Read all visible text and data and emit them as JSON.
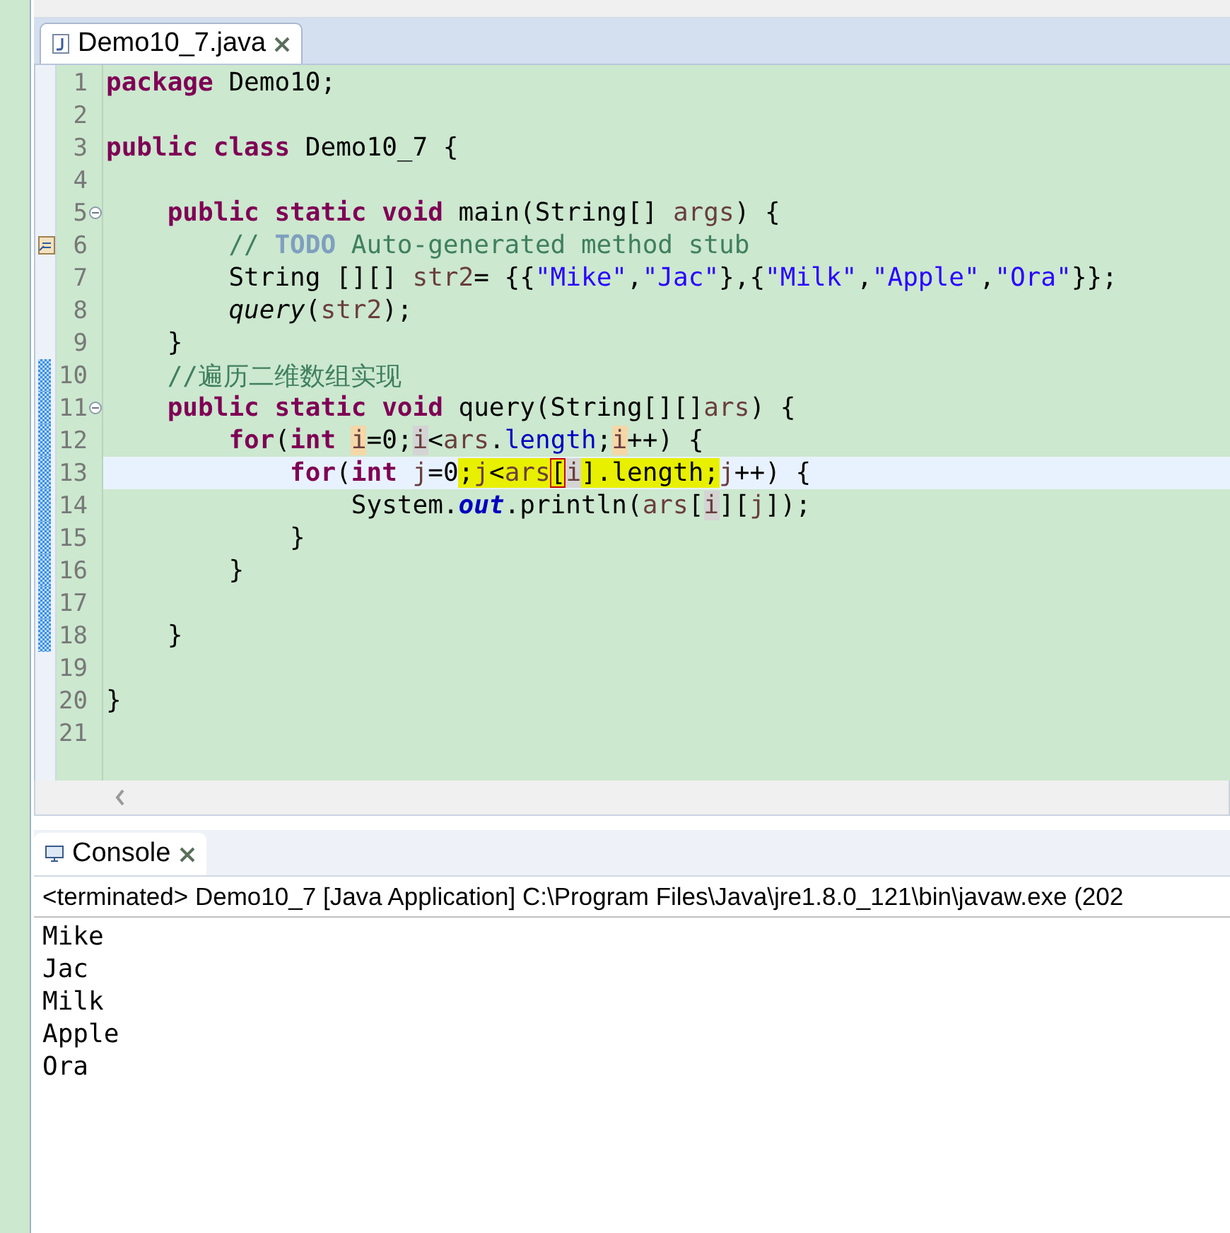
{
  "editor_tab": {
    "title": "Demo10_7.java",
    "selected": true
  },
  "code_lines": [
    {
      "number": "1",
      "current": false,
      "changed": false,
      "fold": false,
      "task": false,
      "tokens": [
        {
          "t": "package ",
          "kind": "kw"
        },
        {
          "t": "Demo10;",
          "kind": "p"
        }
      ]
    },
    {
      "number": "2",
      "current": false,
      "changed": false,
      "fold": false,
      "task": false
    },
    {
      "number": "3",
      "current": false,
      "changed": false,
      "fold": false,
      "task": false,
      "tokens": [
        {
          "t": "public class ",
          "kind": "kw"
        },
        {
          "t": "Demo10_7 {",
          "kind": "p"
        }
      ]
    },
    {
      "number": "4",
      "current": false,
      "changed": false,
      "fold": false,
      "task": false
    },
    {
      "number": "5",
      "current": false,
      "changed": false,
      "fold": true,
      "task": false,
      "tokens": [
        {
          "t": "    public static void ",
          "kind": "kw"
        },
        {
          "t": "main(String[] ",
          "kind": "p"
        },
        {
          "t": "args",
          "kind": "v"
        },
        {
          "t": ") {",
          "kind": "p"
        }
      ]
    },
    {
      "number": "6",
      "current": false,
      "changed": false,
      "fold": false,
      "task": true,
      "tokens": [
        {
          "t": "        // ",
          "kind": "c"
        },
        {
          "t": "TODO",
          "kind": "todo"
        },
        {
          "t": " Auto-generated method stub",
          "kind": "c"
        }
      ]
    },
    {
      "number": "7",
      "current": false,
      "changed": false,
      "fold": false,
      "task": false,
      "tokens": [
        {
          "t": "        String [][] ",
          "kind": "p"
        },
        {
          "t": "str2",
          "kind": "v"
        },
        {
          "t": "= {{",
          "kind": "p"
        },
        {
          "t": "\"Mike\"",
          "kind": "s"
        },
        {
          "t": ",",
          "kind": "p"
        },
        {
          "t": "\"Jac\"",
          "kind": "s"
        },
        {
          "t": "},{",
          "kind": "p"
        },
        {
          "t": "\"Milk\"",
          "kind": "s"
        },
        {
          "t": ",",
          "kind": "p"
        },
        {
          "t": "\"Apple\"",
          "kind": "s"
        },
        {
          "t": ",",
          "kind": "p"
        },
        {
          "t": "\"Ora\"",
          "kind": "s"
        },
        {
          "t": "}};",
          "kind": "p"
        }
      ]
    },
    {
      "number": "8",
      "current": false,
      "changed": false,
      "fold": false,
      "task": false,
      "tokens": [
        {
          "t": "        query",
          "kind": "m"
        },
        {
          "t": "(",
          "kind": "p"
        },
        {
          "t": "str2",
          "kind": "v"
        },
        {
          "t": ");",
          "kind": "p"
        }
      ]
    },
    {
      "number": "9",
      "current": false,
      "changed": false,
      "fold": false,
      "task": false,
      "tokens": [
        {
          "t": "    }",
          "kind": "p"
        }
      ]
    },
    {
      "number": "10",
      "current": false,
      "changed": true,
      "fold": false,
      "task": false,
      "tokens": [
        {
          "t": "    //遍历二维数组实现",
          "kind": "c"
        }
      ]
    },
    {
      "number": "11",
      "current": false,
      "changed": true,
      "fold": true,
      "task": false,
      "tokens": [
        {
          "t": "    public static void ",
          "kind": "kw"
        },
        {
          "t": "query(String[][]",
          "kind": "p"
        },
        {
          "t": "ars",
          "kind": "v"
        },
        {
          "t": ") {",
          "kind": "p"
        }
      ]
    },
    {
      "number": "12",
      "current": false,
      "changed": true,
      "fold": false,
      "task": false,
      "tokens": [
        {
          "t": "        for",
          "kind": "kw"
        },
        {
          "t": "(",
          "kind": "p"
        },
        {
          "t": "int ",
          "kind": "kw"
        },
        {
          "t": "i",
          "kind": "v",
          "write_occurrence": true
        },
        {
          "t": "=0;",
          "kind": "p"
        },
        {
          "t": "i",
          "kind": "v",
          "read_occurrence": true
        },
        {
          "t": "<",
          "kind": "p"
        },
        {
          "t": "ars",
          "kind": "v"
        },
        {
          "t": ".",
          "kind": "p"
        },
        {
          "t": "length",
          "kind": "f"
        },
        {
          "t": ";",
          "kind": "p"
        },
        {
          "t": "i",
          "kind": "v",
          "write_occurrence": true
        },
        {
          "t": "++) {",
          "kind": "p"
        }
      ]
    },
    {
      "number": "13",
      "current": true,
      "changed": true,
      "fold": false,
      "task": false,
      "tokens": [
        {
          "t": "            for",
          "kind": "kw"
        },
        {
          "t": "(",
          "kind": "p"
        },
        {
          "t": "int ",
          "kind": "kw"
        },
        {
          "t": "j",
          "kind": "v"
        },
        {
          "t": "=0",
          "kind": "p"
        },
        {
          "t": ";",
          "kind": "p",
          "marked": true
        },
        {
          "t": "j",
          "kind": "v",
          "marked": true
        },
        {
          "t": "<",
          "kind": "p",
          "marked": true
        },
        {
          "t": "ars",
          "kind": "v",
          "marked": true
        },
        {
          "t": "[",
          "kind": "p",
          "marked": true,
          "bracket_match": true
        },
        {
          "t": "i",
          "kind": "v",
          "read_occurrence": true
        },
        {
          "t": "]",
          "kind": "p",
          "marked": true
        },
        {
          "t": ".length;",
          "kind": "p",
          "marked": true
        },
        {
          "t": "j",
          "kind": "v"
        },
        {
          "t": "++) {",
          "kind": "p"
        }
      ]
    },
    {
      "number": "14",
      "current": false,
      "changed": true,
      "fold": false,
      "task": false,
      "tokens": [
        {
          "t": "                System.",
          "kind": "p"
        },
        {
          "t": "out",
          "kind": "sf"
        },
        {
          "t": ".println(",
          "kind": "p"
        },
        {
          "t": "ars",
          "kind": "v"
        },
        {
          "t": "[",
          "kind": "p"
        },
        {
          "t": "i",
          "kind": "v",
          "read_occurrence": true
        },
        {
          "t": "][",
          "kind": "p"
        },
        {
          "t": "j",
          "kind": "v"
        },
        {
          "t": "]);",
          "kind": "p"
        }
      ]
    },
    {
      "number": "15",
      "current": false,
      "changed": true,
      "fold": false,
      "task": false,
      "tokens": [
        {
          "t": "            }",
          "kind": "p"
        }
      ]
    },
    {
      "number": "16",
      "current": false,
      "changed": true,
      "fold": false,
      "task": false,
      "tokens": [
        {
          "t": "        }",
          "kind": "p"
        }
      ]
    },
    {
      "number": "17",
      "current": false,
      "changed": true,
      "fold": false,
      "task": false
    },
    {
      "number": "18",
      "current": false,
      "changed": true,
      "fold": false,
      "task": false,
      "tokens": [
        {
          "t": "    }",
          "kind": "p"
        }
      ]
    },
    {
      "number": "19",
      "current": false,
      "changed": false,
      "fold": false,
      "task": false
    },
    {
      "number": "20",
      "current": false,
      "changed": false,
      "fold": false,
      "task": false,
      "tokens": [
        {
          "t": "}",
          "kind": "p"
        }
      ]
    },
    {
      "number": "21",
      "current": false,
      "changed": false,
      "fold": false,
      "task": false
    }
  ],
  "console": {
    "tab": {
      "title": "Console",
      "selected": true
    },
    "header": "<terminated> Demo10_7 [Java Application] C:\\Program Files\\Java\\jre1.8.0_121\\bin\\javaw.exe (202",
    "output": [
      "Mike",
      "Jac",
      "Milk",
      "Apple",
      "Ora"
    ]
  }
}
